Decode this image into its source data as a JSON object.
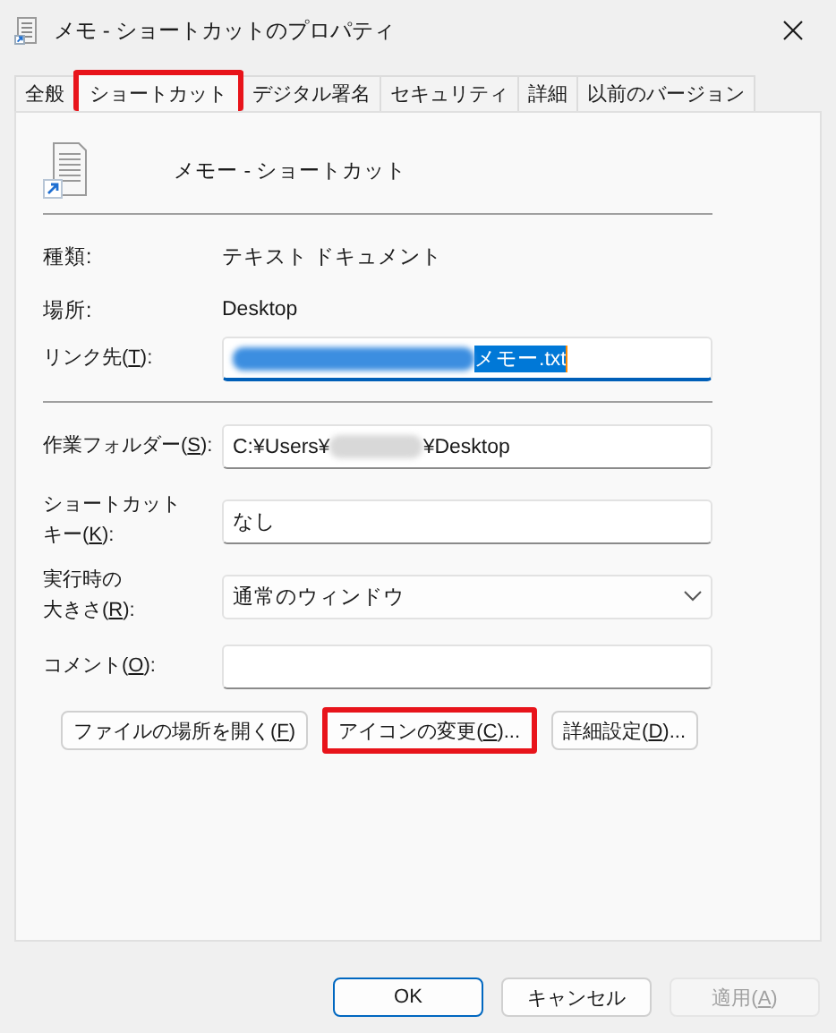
{
  "window": {
    "title": "メモ - ショートカットのプロパティ"
  },
  "tabs": [
    {
      "label": "全般",
      "selected": false,
      "highlighted": false
    },
    {
      "label": "ショートカット",
      "selected": true,
      "highlighted": true
    },
    {
      "label": "デジタル署名",
      "selected": false,
      "highlighted": false
    },
    {
      "label": "セキュリティ",
      "selected": false,
      "highlighted": false
    },
    {
      "label": "詳細",
      "selected": false,
      "highlighted": false
    },
    {
      "label": "以前のバージョン",
      "selected": false,
      "highlighted": false
    }
  ],
  "header": {
    "name": "メモー - ショートカット"
  },
  "info": [
    {
      "label": "種類:",
      "value": "テキスト ドキュメント"
    },
    {
      "label": "場所:",
      "value": "Desktop"
    }
  ],
  "target": {
    "label_parts": [
      "リンク先(",
      "T",
      "):"
    ],
    "segments": [
      {
        "kind": "redacted"
      },
      {
        "kind": "text",
        "text": "メモー.txt"
      }
    ],
    "selected": true,
    "focused": true
  },
  "fields": [
    {
      "kind": "text",
      "label_parts": [
        "作業フォルダー(",
        "S",
        "):"
      ],
      "segments": [
        {
          "kind": "text",
          "text": "C:¥Users¥"
        },
        {
          "kind": "redacted"
        },
        {
          "kind": "text",
          "text": "¥Desktop"
        }
      ]
    },
    {
      "kind": "text",
      "label_lines": [
        [
          "ショートカット"
        ],
        [
          "キー(",
          "K",
          "):"
        ]
      ],
      "segments": [
        {
          "kind": "text",
          "text": "なし"
        }
      ]
    },
    {
      "kind": "dropdown",
      "label_lines": [
        [
          "実行時の"
        ],
        [
          "大きさ(",
          "R",
          "):"
        ]
      ],
      "segments": [
        {
          "kind": "text",
          "text": "通常のウィンドウ"
        }
      ]
    },
    {
      "kind": "text",
      "label_parts": [
        "コメント(",
        "O",
        "):"
      ]
    }
  ],
  "actions": [
    {
      "label_parts": [
        "ファイルの場所を開く(",
        "F",
        ")"
      ],
      "highlighted": false
    },
    {
      "label_parts": [
        "アイコンの変更(",
        "C",
        ")..."
      ],
      "highlighted": true
    },
    {
      "label_parts": [
        "詳細設定(",
        "D",
        ")..."
      ],
      "highlighted": false
    }
  ],
  "dialog_buttons": [
    {
      "label_parts": [
        "OK"
      ],
      "default": true,
      "disabled": false
    },
    {
      "label_parts": [
        "キャンセル"
      ],
      "default": false,
      "disabled": false
    },
    {
      "label_parts": [
        "適用(",
        "A",
        ")"
      ],
      "default": false,
      "disabled": true
    }
  ]
}
